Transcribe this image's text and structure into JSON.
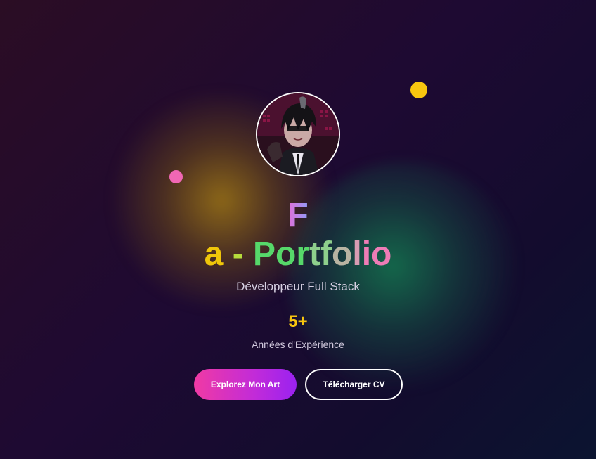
{
  "hero": {
    "title_line1": "F",
    "title_line2_parts": [
      "a",
      "-",
      "P",
      "o",
      "r",
      "t",
      "f",
      "o",
      "l",
      "i",
      "o"
    ],
    "subtitle": "Développeur Full Stack",
    "stat_number": "5+",
    "stat_label": "Années d'Expérience"
  },
  "buttons": {
    "primary_label": "Explorez Mon Art",
    "secondary_label": "Télécharger CV"
  },
  "colors": {
    "accent_yellow": "#f8c60f",
    "accent_pink": "#f067b4",
    "primary_gradient_start": "#f03aa4",
    "primary_gradient_end": "#9a22f0"
  },
  "avatar": {
    "icon": "profile-avatar-image"
  }
}
